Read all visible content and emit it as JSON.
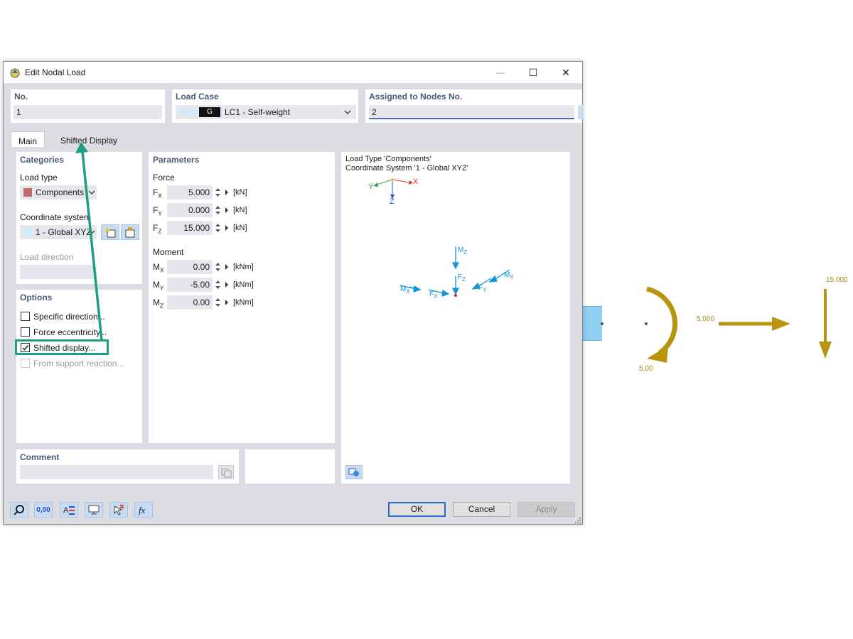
{
  "window": {
    "title": "Edit Nodal Load",
    "minimize": "—",
    "maximize": "☐",
    "close": "✕"
  },
  "top": {
    "no_label": "No.",
    "no_value": "1",
    "load_case_label": "Load Case",
    "load_case_badge": "G",
    "load_case_value": "LC1 - Self-weight",
    "nodes_label": "Assigned to Nodes No.",
    "nodes_value": "2"
  },
  "tabs": [
    {
      "label": "Main",
      "active": true
    },
    {
      "label": "Shifted Display",
      "active": false
    }
  ],
  "categories": {
    "header": "Categories",
    "load_type_label": "Load type",
    "load_type_value": "Components",
    "coord_label": "Coordinate system",
    "coord_value": "1 - Global XYZ",
    "load_dir_label": "Load direction"
  },
  "options": {
    "header": "Options",
    "items": [
      {
        "label": "Specific direction...",
        "checked": false,
        "enabled": true
      },
      {
        "label": "Force eccentricity...",
        "checked": false,
        "enabled": true
      },
      {
        "label": "Shifted display...",
        "checked": true,
        "enabled": true
      },
      {
        "label": "From support reaction...",
        "checked": false,
        "enabled": false
      }
    ]
  },
  "parameters": {
    "header": "Parameters",
    "force_label": "Force",
    "moment_label": "Moment",
    "forces": [
      {
        "sym": "F",
        "sub": "X",
        "value": "5.000",
        "unit": "[kN]"
      },
      {
        "sym": "F",
        "sub": "Y",
        "value": "0.000",
        "unit": "[kN]"
      },
      {
        "sym": "F",
        "sub": "Z",
        "value": "15.000",
        "unit": "[kN]"
      }
    ],
    "moments": [
      {
        "sym": "M",
        "sub": "X",
        "value": "0.00",
        "unit": "[kNm]"
      },
      {
        "sym": "M",
        "sub": "Y",
        "value": "-5.00",
        "unit": "[kNm]"
      },
      {
        "sym": "M",
        "sub": "Z",
        "value": "0.00",
        "unit": "[kNm]"
      }
    ]
  },
  "preview": {
    "line1": "Load Type 'Components'",
    "line2": "Coordinate System '1 - Global XYZ'",
    "axis_x": "X",
    "axis_y": "Y",
    "axis_z": "Z",
    "mz": "M",
    "mz_sub": "Z",
    "fz": "F",
    "fz_sub": "Z",
    "my": "M",
    "my_sub": "Y",
    "fy": "F",
    "fy_sub": "Y",
    "mx": "M",
    "mx_sub": "X",
    "fx": "F",
    "fx_sub": "X"
  },
  "comment": {
    "label": "Comment",
    "value": ""
  },
  "buttons": {
    "ok": "OK",
    "cancel": "Cancel",
    "apply": "Apply"
  },
  "toolbar_zero": "0,00",
  "model_view": {
    "label_fx": "5.000",
    "label_fz": "15.000",
    "label_my": "5.00"
  },
  "colors": {
    "accent_green": "#1e9e80",
    "load_gold": "#b8940f",
    "diagram_blue": "#1296d4",
    "primary_blue": "#2a6fc9"
  }
}
